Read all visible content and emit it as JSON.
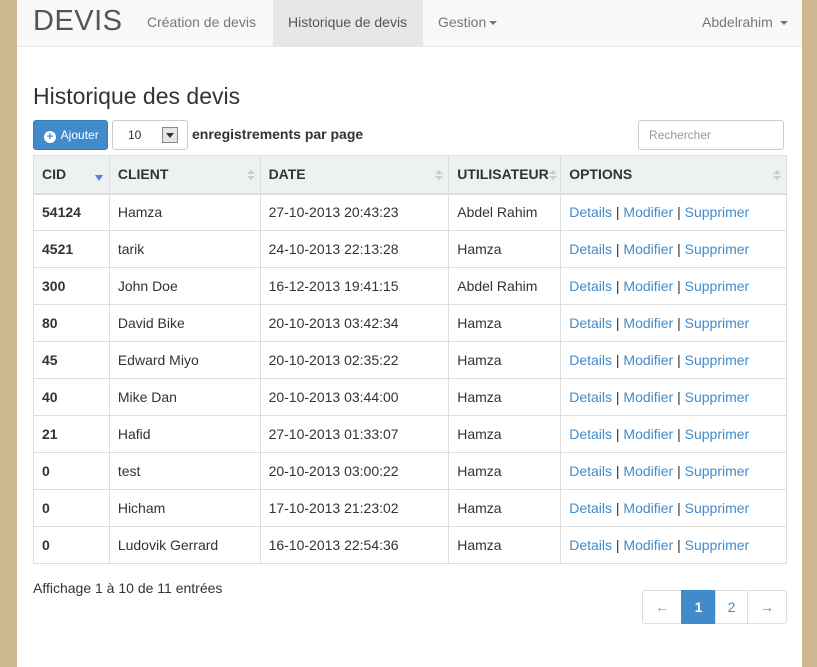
{
  "navbar": {
    "brand": "DEVIS",
    "items": [
      {
        "label": "Création de devis"
      },
      {
        "label": "Historique de devis"
      },
      {
        "label": "Gestion"
      }
    ],
    "user": "Abdelrahim"
  },
  "page": {
    "title": "Historique des devis"
  },
  "toolbar": {
    "add_label": "Ajouter",
    "page_size": "10",
    "page_size_label": "enregistrements par page",
    "search_placeholder": "Rechercher"
  },
  "table": {
    "columns": [
      "CID",
      "CLIENT",
      "DATE",
      "UTILISATEUR",
      "OPTIONS"
    ],
    "sort_column": "CID",
    "sort_direction": "desc",
    "option_labels": {
      "details": "Details",
      "modifier": "Modifier",
      "supprimer": "Supprimer",
      "separator": "|"
    },
    "rows": [
      {
        "cid": "54124",
        "client": "Hamza",
        "date": "27-10-2013 20:43:23",
        "user": "Abdel Rahim"
      },
      {
        "cid": "4521",
        "client": "tarik",
        "date": "24-10-2013 22:13:28",
        "user": "Hamza"
      },
      {
        "cid": "300",
        "client": "John Doe",
        "date": "16-12-2013 19:41:15",
        "user": "Abdel Rahim"
      },
      {
        "cid": "80",
        "client": "David Bike",
        "date": "20-10-2013 03:42:34",
        "user": "Hamza"
      },
      {
        "cid": "45",
        "client": "Edward Miyo",
        "date": "20-10-2013 02:35:22",
        "user": "Hamza"
      },
      {
        "cid": "40",
        "client": "Mike Dan",
        "date": "20-10-2013 03:44:00",
        "user": "Hamza"
      },
      {
        "cid": "21",
        "client": "Hafid",
        "date": "27-10-2013 01:33:07",
        "user": "Hamza"
      },
      {
        "cid": "0",
        "client": "test",
        "date": "20-10-2013 03:00:22",
        "user": "Hamza"
      },
      {
        "cid": "0",
        "client": "Hicham",
        "date": "17-10-2013 21:23:02",
        "user": "Hamza"
      },
      {
        "cid": "0",
        "client": "Ludovik Gerrard",
        "date": "16-10-2013 22:54:36",
        "user": "Hamza"
      }
    ]
  },
  "footer": {
    "info": "Affichage 1 à 10 de 11 entrées",
    "pagination": {
      "prev": "←",
      "pages": [
        "1",
        "2"
      ],
      "current": "1",
      "next": "→"
    }
  },
  "colors": {
    "primary": "#428bca",
    "navbar_bg": "#f8f8f8",
    "header_bg": "#edf1f2",
    "background": "#d4bf97"
  },
  "icons": {
    "add": "plus-circle-icon",
    "dropdown": "caret-down-icon",
    "sort": "sort-icon",
    "sort_active": "sort-desc-icon"
  }
}
